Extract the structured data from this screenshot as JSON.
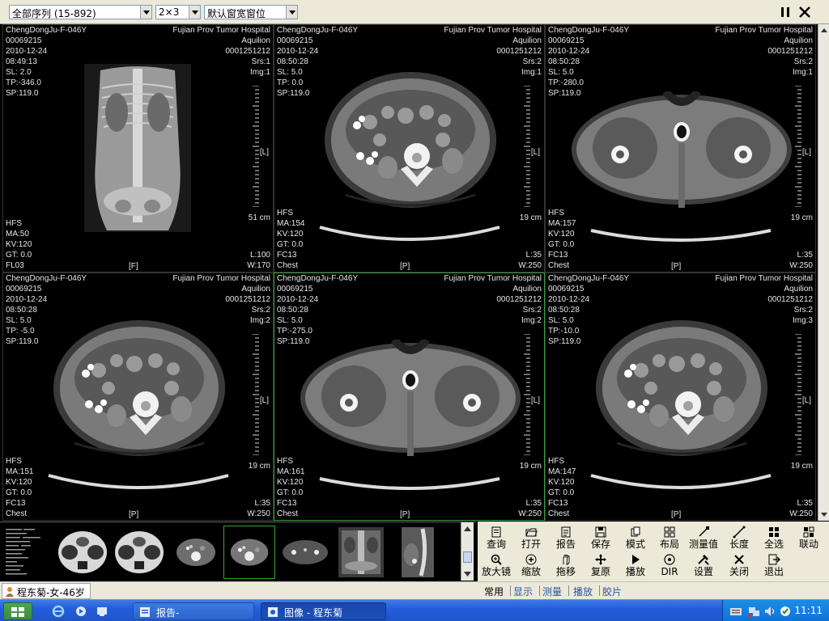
{
  "toolbar": {
    "series_select": "全部序列 (15-892)",
    "layout_select": "2×3",
    "window_select": "默认窗宽窗位"
  },
  "viewports": [
    {
      "tl": [
        "ChengDongJu-F-046Y",
        "00069215",
        "2010-12-24",
        "08:49:13",
        "SL:  2.0",
        "TP:-346.0",
        "SP:119.0"
      ],
      "tr": [
        "Fujian Prov Tumor Hospital",
        "Aquilion",
        "0001251212",
        "Srs:1",
        "Img:1"
      ],
      "bl": [
        "HFS",
        "MA:50",
        "KV:120",
        "GT:  0.0",
        "FL03"
      ],
      "br": [
        "L:100",
        "W:170"
      ],
      "scale": "51 cm",
      "orient": "[L]",
      "bottom_orient": "[F]",
      "image": "scout-icon"
    },
    {
      "tl": [
        "ChengDongJu-F-046Y",
        "00069215",
        "2010-12-24",
        "08:50:28",
        "SL:  5.0",
        "TP:  0.0",
        "SP:119.0"
      ],
      "tr": [
        "Fujian Prov Tumor Hospital",
        "Aquilion",
        "0001251212",
        "Srs:2",
        "Img:1"
      ],
      "bl": [
        "HFS",
        "MA:154",
        "KV:120",
        "GT:  0.0",
        "FC13",
        "Chest"
      ],
      "br": [
        "L:35",
        "W:250"
      ],
      "scale": "19 cm",
      "orient": "[L]",
      "bottom_orient": "[P]",
      "image": "abdomen-ct-icon"
    },
    {
      "tl": [
        "ChengDongJu-F-046Y",
        "00069215",
        "2010-12-24",
        "08:50:28",
        "SL:  5.0",
        "TP:-280.0",
        "SP:119.0"
      ],
      "tr": [
        "Fujian Prov Tumor Hospital",
        "Aquilion",
        "0001251212",
        "Srs:2",
        "Img:1"
      ],
      "bl": [
        "HFS",
        "MA:157",
        "KV:120",
        "GT:  0.0",
        "FC13",
        "Chest"
      ],
      "br": [
        "L:35",
        "W:250"
      ],
      "scale": "19 cm",
      "orient": "[L]",
      "bottom_orient": "[P]",
      "image": "pelvis-ct-icon"
    },
    {
      "tl": [
        "ChengDongJu-F-046Y",
        "00069215",
        "2010-12-24",
        "08:50:28",
        "SL:  5.0",
        "TP: -5.0",
        "SP:119.0"
      ],
      "tr": [
        "Fujian Prov Tumor Hospital",
        "Aquilion",
        "0001251212",
        "Srs:2",
        "Img:2"
      ],
      "bl": [
        "HFS",
        "MA:151",
        "KV:120",
        "GT:  0.0",
        "FC13",
        "Chest"
      ],
      "br": [
        "L:35",
        "W:250"
      ],
      "scale": "19 cm",
      "orient": "[L]",
      "bottom_orient": "[P]",
      "image": "abdomen-ct-icon"
    },
    {
      "tl": [
        "ChengDongJu-F-046Y",
        "00069215",
        "2010-12-24",
        "08:50:28",
        "SL:  5.0",
        "TP:-275.0",
        "SP:119.0"
      ],
      "tr": [
        "Fujian Prov Tumor Hospital",
        "Aquilion",
        "0001251212",
        "Srs:2",
        "Img:2"
      ],
      "bl": [
        "HFS",
        "MA:161",
        "KV:120",
        "GT:  0.0",
        "FC13",
        "Chest"
      ],
      "br": [
        "L:35",
        "W:250"
      ],
      "scale": "19 cm",
      "orient": "[L]",
      "bottom_orient": "[P]",
      "image": "pelvis-ct-icon"
    },
    {
      "tl": [
        "ChengDongJu-F-046Y",
        "00069215",
        "2010-12-24",
        "08:50:28",
        "SL:  5.0",
        "TP:-10.0",
        "SP:119.0"
      ],
      "tr": [
        "Fujian Prov Tumor Hospital",
        "Aquilion",
        "0001251212",
        "Srs:2",
        "Img:3"
      ],
      "bl": [
        "HFS",
        "MA:147",
        "KV:120",
        "GT:  0.0",
        "FC13",
        "Chest"
      ],
      "br": [
        "L:35",
        "W:250"
      ],
      "scale": "19 cm",
      "orient": "[L]",
      "bottom_orient": "[P]",
      "image": "abdomen-ct-icon"
    }
  ],
  "tools_row1": [
    {
      "label": "查询",
      "icon": "query-icon"
    },
    {
      "label": "打开",
      "icon": "open-icon"
    },
    {
      "label": "报告",
      "icon": "report-icon"
    },
    {
      "label": "保存",
      "icon": "save-icon"
    },
    {
      "label": "模式",
      "icon": "mode-icon"
    },
    {
      "label": "布局",
      "icon": "layout-icon"
    },
    {
      "label": "测量值",
      "icon": "measure-value-icon"
    },
    {
      "label": "长度",
      "icon": "length-icon"
    },
    {
      "label": "全选",
      "icon": "select-all-icon"
    },
    {
      "label": "联动",
      "icon": "link-icon"
    }
  ],
  "tools_row2": [
    {
      "label": "放大镜",
      "icon": "magnifier-icon"
    },
    {
      "label": "缩放",
      "icon": "zoom-icon"
    },
    {
      "label": "拖移",
      "icon": "pan-icon"
    },
    {
      "label": "复原",
      "icon": "reset-icon"
    },
    {
      "label": "播放",
      "icon": "play-icon"
    },
    {
      "label": "DIR",
      "icon": "dir-icon"
    },
    {
      "label": "设置",
      "icon": "settings-icon"
    },
    {
      "label": "关闭",
      "icon": "close-icon"
    },
    {
      "label": "退出",
      "icon": "exit-icon"
    }
  ],
  "bottom_tabs": [
    "常用",
    "显示",
    "测量",
    "播放",
    "胶片"
  ],
  "patient_tab": "程东菊-女-46岁",
  "taskbar": {
    "report_button": "报告-",
    "image_button": "图像 - 程东菊",
    "clock": "11:11"
  },
  "colors": {
    "active_border": "#3c9a3c",
    "panel_bg": "#ece9d8",
    "taskbar_blue": "#245edb"
  }
}
